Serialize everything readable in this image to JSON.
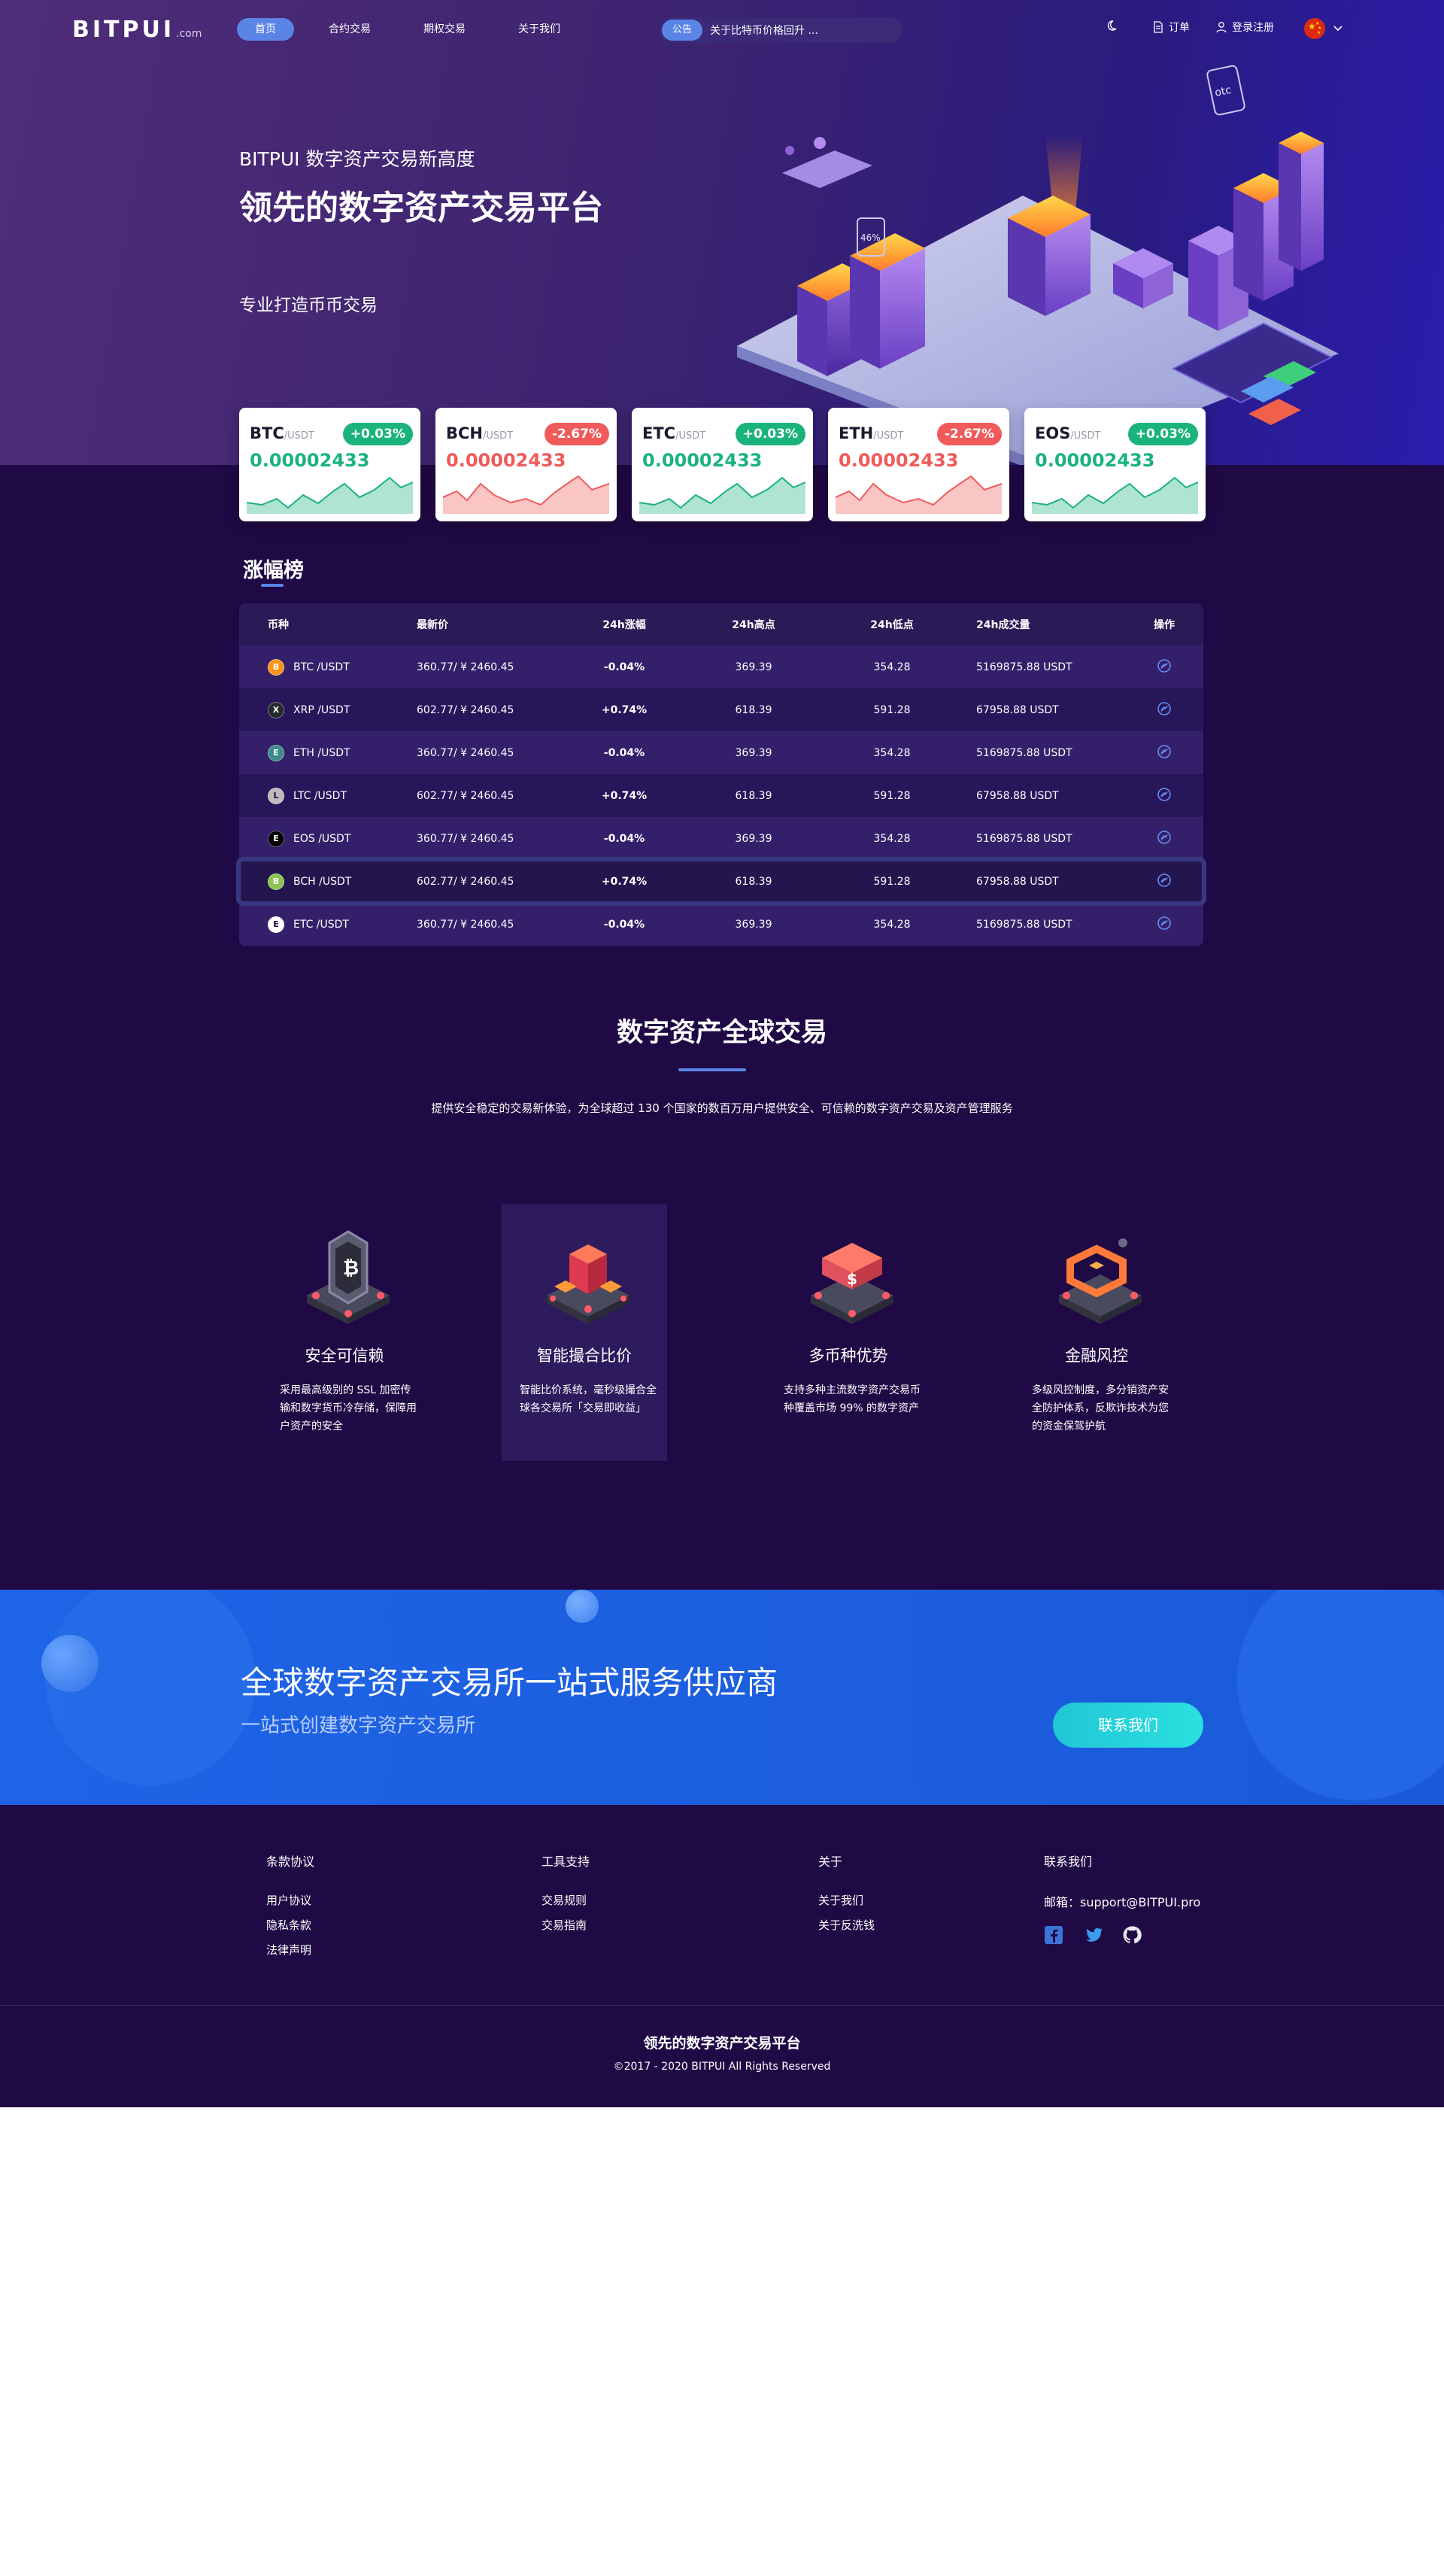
{
  "brand": {
    "logo": "BITPUI",
    "logo_suffix": ".com"
  },
  "nav": {
    "items": [
      {
        "label": "首页",
        "active": true
      },
      {
        "label": "合约交易",
        "active": false
      },
      {
        "label": "期权交易",
        "active": false
      },
      {
        "label": "关于我们",
        "active": false
      }
    ],
    "notice_tag": "公告",
    "notice_text": "关于比特币价格回升 ...",
    "orders_label": "订单",
    "login_label": "登录注册",
    "language_flag": "china-flag-icon"
  },
  "hero": {
    "kicker": "BITPUI 数字资产交易新高度",
    "title": "领先的数字资产交易平台",
    "subtitle": "专业打造币币交易"
  },
  "tickers": [
    {
      "symbol": "BTC",
      "quote": "/USDT",
      "change": "+0.03%",
      "price": "0.00002433",
      "trend": "up"
    },
    {
      "symbol": "BCH",
      "quote": "/USDT",
      "change": "-2.67%",
      "price": "0.00002433",
      "trend": "down"
    },
    {
      "symbol": "ETC",
      "quote": "/USDT",
      "change": "+0.03%",
      "price": "0.00002433",
      "trend": "up"
    },
    {
      "symbol": "ETH",
      "quote": "/USDT",
      "change": "-2.67%",
      "price": "0.00002433",
      "trend": "down"
    },
    {
      "symbol": "EOS",
      "quote": "/USDT",
      "change": "+0.03%",
      "price": "0.00002433",
      "trend": "up"
    }
  ],
  "ranking": {
    "title": "涨幅榜",
    "headers": [
      "币种",
      "最新价",
      "24h涨幅",
      "24h高点",
      "24h低点",
      "24h成交量",
      "操作"
    ],
    "rows": [
      {
        "pair": "BTC /USDT",
        "icon": "btc-icon",
        "color": "#f7931a",
        "price": "360.77/ ¥ 2460.45",
        "change": "-0.04%",
        "high": "369.39",
        "low": "354.28",
        "volume": "5169875.88 USDT"
      },
      {
        "pair": "XRP /USDT",
        "icon": "xrp-icon",
        "color": "#23292f",
        "price": "602.77/ ¥ 2460.45",
        "change": "+0.74%",
        "high": "618.39",
        "low": "591.28",
        "volume": "67958.88 USDT"
      },
      {
        "pair": "ETH /USDT",
        "icon": "eth-icon",
        "color": "#3c8a8a",
        "price": "360.77/ ¥ 2460.45",
        "change": "-0.04%",
        "high": "369.39",
        "low": "354.28",
        "volume": "5169875.88 USDT"
      },
      {
        "pair": "LTC /USDT",
        "icon": "ltc-icon",
        "color": "#bfbbbb",
        "price": "602.77/ ¥ 2460.45",
        "change": "+0.74%",
        "high": "618.39",
        "low": "591.28",
        "volume": "67958.88 USDT"
      },
      {
        "pair": "EOS /USDT",
        "icon": "eos-icon",
        "color": "#000000",
        "price": "360.77/ ¥ 2460.45",
        "change": "-0.04%",
        "high": "369.39",
        "low": "354.28",
        "volume": "5169875.88 USDT"
      },
      {
        "pair": "BCH /USDT",
        "icon": "bch-icon",
        "color": "#8dc351",
        "price": "602.77/ ¥ 2460.45",
        "change": "+0.74%",
        "high": "618.39",
        "low": "591.28",
        "volume": "67958.88 USDT"
      },
      {
        "pair": "ETC /USDT",
        "icon": "etc-icon",
        "color": "#ffffff",
        "price": "360.77/ ¥ 2460.45",
        "change": "-0.04%",
        "high": "369.39",
        "low": "354.28",
        "volume": "5169875.88 USDT"
      }
    ],
    "highlighted_row": 5
  },
  "global": {
    "title": "数字资产全球交易",
    "desc": "提供安全稳定的交易新体验，为全球超过 130 个国家的数百万用户提供安全、可信赖的数字资产交易及资产管理服务",
    "features": [
      {
        "title": "安全可信赖",
        "desc": "采用最高级别的 SSL 加密传输和数字货币冷存储，保障用户资产的安全",
        "icon": "shield-block-icon",
        "active": false
      },
      {
        "title": "智能撮合比价",
        "desc": "智能比价系统，毫秒级撮合全球各交易所「交易即收益」",
        "icon": "cube-matching-icon",
        "active": true
      },
      {
        "title": "多币种优势",
        "desc": "支持多种主流数字资产交易币种覆盖市场 99% 的数字资产",
        "icon": "coin-stack-icon",
        "active": false
      },
      {
        "title": "金融风控",
        "desc": "多级风控制度，多分销资产安全防护体系，反欺诈技术为您的资金保驾护航",
        "icon": "risk-control-icon",
        "active": false
      }
    ]
  },
  "band": {
    "title": "全球数字资产交易所一站式服务供应商",
    "subtitle": "一站式创建数字资产交易所",
    "button": "联系我们"
  },
  "footer": {
    "col1": {
      "heading": "条款协议",
      "links": [
        "用户协议",
        "隐私条款",
        "法律声明"
      ]
    },
    "col2": {
      "heading": "工具支持",
      "links": [
        "交易规则",
        "交易指南"
      ]
    },
    "col3": {
      "heading": "关于",
      "links": [
        "关于我们",
        "关于反洗钱"
      ]
    },
    "col4": {
      "heading": "联系我们",
      "email": "邮箱：support@BITPUI.pro",
      "social": [
        "facebook-icon",
        "twitter-icon",
        "github-icon"
      ]
    },
    "brand": "领先的数字资产交易平台",
    "copyright": "©2017 - 2020 BITPUI All Rights Reserved"
  },
  "colors": {
    "accent": "#5a84e6",
    "up": "#1ab37c",
    "down": "#f05a5a",
    "page_bg": "#1f0a45",
    "band": "#1e64e6"
  }
}
